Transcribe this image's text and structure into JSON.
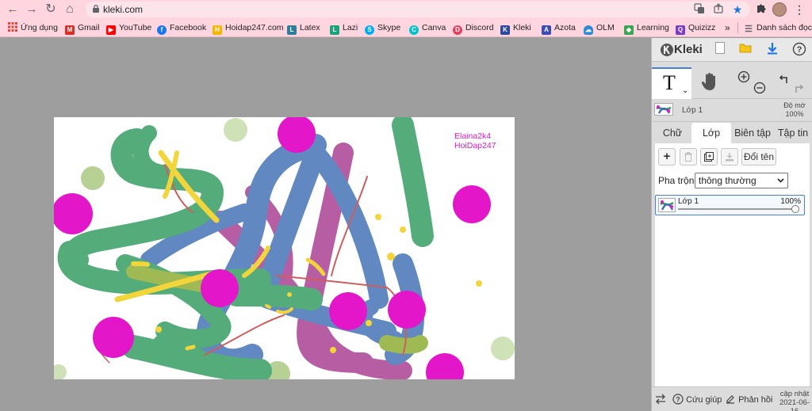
{
  "browser": {
    "url": "kleki.com",
    "nav": {
      "back": "←",
      "forward": "→",
      "reload": "↻",
      "home": "⌂"
    },
    "bookmarks": [
      {
        "label": "Ứng dụng",
        "icon": "apps-grid-icon",
        "color": "#e8453c"
      },
      {
        "label": "Gmail",
        "icon": "gmail-icon",
        "color": "#d93025"
      },
      {
        "label": "YouTube",
        "icon": "youtube-icon",
        "color": "#ff0000"
      },
      {
        "label": "Facebook",
        "icon": "facebook-icon",
        "color": "#1877f2"
      },
      {
        "label": "Hoidap247.com",
        "icon": "hoidap-icon",
        "color": "#f2b705"
      },
      {
        "label": "Latex",
        "icon": "latex-icon",
        "color": "#2e7d9a"
      },
      {
        "label": "Lazi",
        "icon": "lazi-icon",
        "color": "#19a47a"
      },
      {
        "label": "Skype",
        "icon": "skype-icon",
        "color": "#00aff0"
      },
      {
        "label": "Canva",
        "icon": "canva-icon",
        "color": "#00c4cc"
      },
      {
        "label": "Discord",
        "icon": "discord-icon",
        "color": "#e4405f"
      },
      {
        "label": "Kleki",
        "icon": "kleki-icon",
        "color": "#2b4aa0"
      },
      {
        "label": "Azota",
        "icon": "azota-icon",
        "color": "#3a4fb3"
      },
      {
        "label": "OLM",
        "icon": "olm-icon",
        "color": "#2e8bd6"
      },
      {
        "label": "Learning",
        "icon": "learning-icon",
        "color": "#34a853"
      },
      {
        "label": "Quizizz",
        "icon": "quizizz-icon",
        "color": "#7a3cc3"
      }
    ],
    "overflow": "»",
    "reading_list": "Danh sách đọc"
  },
  "canvas": {
    "signature_line1": "Elaina2k4",
    "signature_line2": "HoiDap247"
  },
  "panel": {
    "app_name": "Kleki",
    "tool_glyph": "T",
    "tool_sub": "⌄",
    "layer_preview": {
      "name": "Lớp 1",
      "opacity_label": "Độ mờ",
      "opacity": "100%"
    },
    "tabs": [
      {
        "label": "Chữ",
        "active": false
      },
      {
        "label": "Lớp",
        "active": true
      },
      {
        "label": "Biên tập",
        "active": false
      },
      {
        "label": "Tập tin",
        "active": false
      }
    ],
    "layer_buttons": {
      "add": "+",
      "delete": "🗑",
      "duplicate": "⧉",
      "merge": "⤓",
      "rename": "Đổi tên"
    },
    "blend": {
      "label": "Pha trộn",
      "value": "thông thường"
    },
    "layers": [
      {
        "name": "Lớp 1",
        "opacity": "100%",
        "opacity_value": 1.0
      }
    ],
    "footer": {
      "help": "Cứu giúp",
      "feedback": "Phản hồi",
      "update_label": "cập nhật",
      "update_date": "2021-06-16"
    }
  }
}
